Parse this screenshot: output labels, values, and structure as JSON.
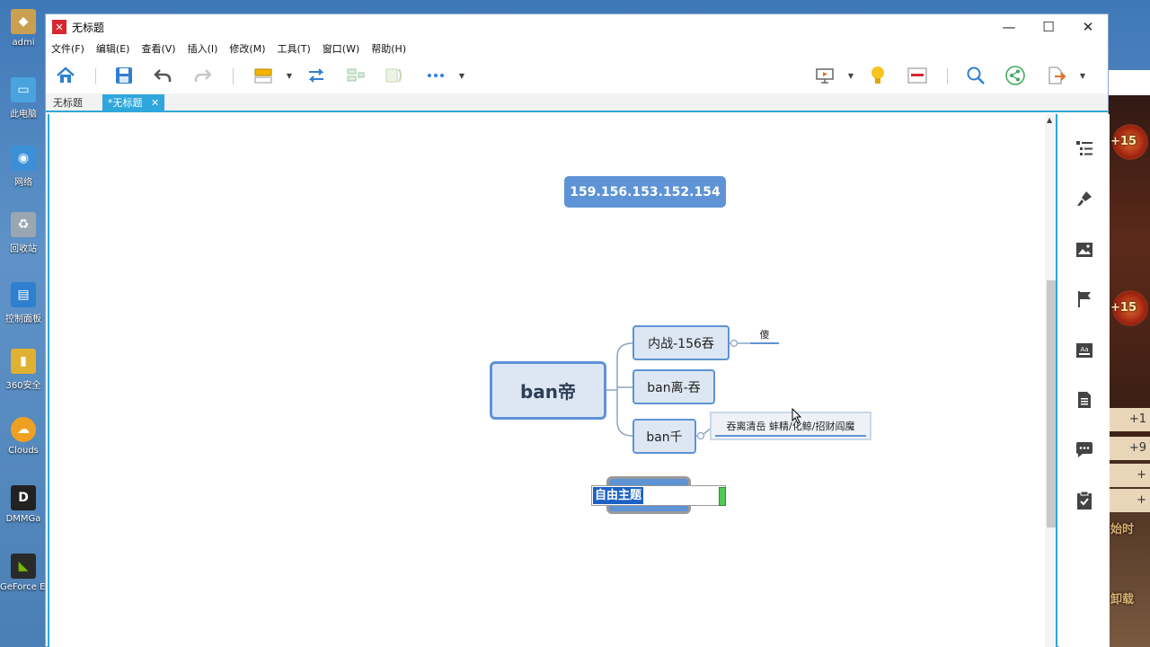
{
  "desktop": {
    "icons": [
      {
        "label": "admi",
        "color": "#caa050"
      },
      {
        "label": "此电脑",
        "color": "#4aa3df"
      },
      {
        "label": "网络",
        "color": "#3b8fd6"
      },
      {
        "label": "回收站",
        "color": "#9aa7b3"
      },
      {
        "label": "控制面板",
        "color": "#2f7fd0"
      },
      {
        "label": "360安全",
        "color": "#e0b030"
      },
      {
        "label": "Clouds",
        "color": "#f0a020"
      },
      {
        "label": "DMMGa",
        "color": "#222222"
      },
      {
        "label": "GeForce Experien",
        "color": "#2a2a2a"
      }
    ]
  },
  "background_window": {
    "badges": [
      "+15",
      "+15"
    ],
    "rows": [
      "+1",
      "+9",
      "+",
      "+"
    ],
    "texts": [
      "始时",
      "卸载"
    ]
  },
  "window": {
    "title": "无标题",
    "controls": {
      "minimize": "—",
      "maximize": "☐",
      "close": "✕"
    }
  },
  "menu": [
    "文件(F)",
    "编辑(E)",
    "查看(V)",
    "插入(I)",
    "修改(M)",
    "工具(T)",
    "窗口(W)",
    "帮助(H)"
  ],
  "tabs": [
    {
      "label": "无标题",
      "active": false
    },
    {
      "label": "*无标题",
      "active": true,
      "close": "✕"
    }
  ],
  "mindmap": {
    "floating_topic": "159.156.153.152.154",
    "central_topic": "ban帝",
    "subtopics": [
      {
        "label": "内战-156吞",
        "child": "傻"
      },
      {
        "label": "ban离-吞"
      },
      {
        "label": "ban千",
        "child": "吞离清岳 蚌精/化鲸/招财阎魔"
      }
    ],
    "free_topic": "自由主题"
  },
  "colors": {
    "accent": "#2fa7dc",
    "node_fill": "#dde7f3",
    "node_border": "#5e93d6",
    "selection": "#1c62c6"
  }
}
